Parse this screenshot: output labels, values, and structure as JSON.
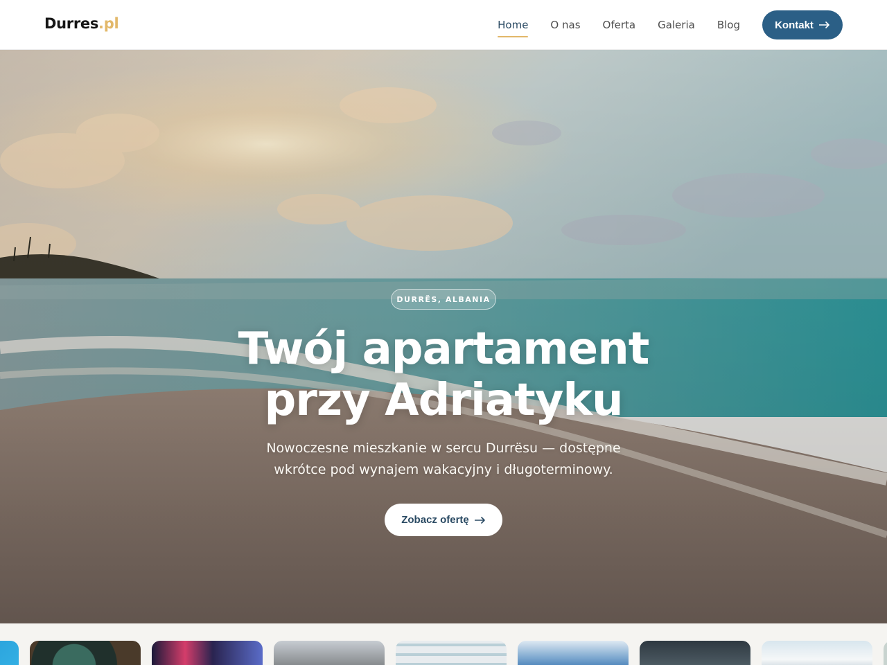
{
  "header": {
    "logo_main": "Durres",
    "logo_tld": ".pl",
    "nav": [
      {
        "label": "Home",
        "active": true
      },
      {
        "label": "O nas",
        "active": false
      },
      {
        "label": "Oferta",
        "active": false
      },
      {
        "label": "Galeria",
        "active": false
      },
      {
        "label": "Blog",
        "active": false
      }
    ],
    "cta_label": "Kontakt",
    "cta_icon": "arrow-right-icon"
  },
  "hero": {
    "badge": "DURRËS, ALBANIA",
    "title_line1": "Twój apartament",
    "title_line2": "przy Adriatyku",
    "subtitle_line1": "Nowoczesne mieszkanie w sercu Durrësu — dostępne",
    "subtitle_line2": "wkrótce pod wynajem wakacyjny i długoterminowy.",
    "button_label": "Zobacz ofertę",
    "button_icon": "arrow-right-icon"
  },
  "gallery": {
    "thumbnails": [
      "pool",
      "dinner-table",
      "neon-street",
      "mountains",
      "hotel-balconies",
      "coastline",
      "harbor-dusk",
      "yacht"
    ]
  },
  "colors": {
    "accent": "#e2b86a",
    "primary": "#2b5f86",
    "nav_text": "#4d4d4d"
  }
}
